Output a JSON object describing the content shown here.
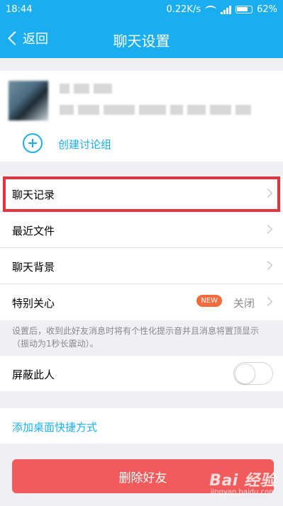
{
  "status_bar": {
    "time": "18:44",
    "speed": "0.22K/s",
    "battery": "62%"
  },
  "nav": {
    "back_label": "返回",
    "title": "聊天设置"
  },
  "profile": {
    "create_group_label": "创建讨论组"
  },
  "settings": {
    "items": [
      {
        "label": "聊天记录"
      },
      {
        "label": "最近文件"
      },
      {
        "label": "聊天背景"
      },
      {
        "label": "特别关心",
        "badge": "NEW",
        "value": "关闭"
      }
    ],
    "hint": "设置后，收到此好友消息时将有个性化提示音并且消息将置顶显示（振动为1秒长震动）。"
  },
  "block": {
    "label": "屏蔽此人",
    "enabled": false
  },
  "shortcut_label": "添加桌面快捷方式",
  "delete_label": "删除好友",
  "watermark": {
    "main": "Bai 经验",
    "sub": "jingyan.baidu.com"
  },
  "colors": {
    "accent": "#1aaef1",
    "danger": "#f25b5b",
    "highlight": "#e8313d",
    "badge": "#f36a3d"
  },
  "icons": {
    "back": "chevron-left-icon",
    "create_group": "plus-circle-icon",
    "row_arrow": "chevron-right-icon"
  }
}
